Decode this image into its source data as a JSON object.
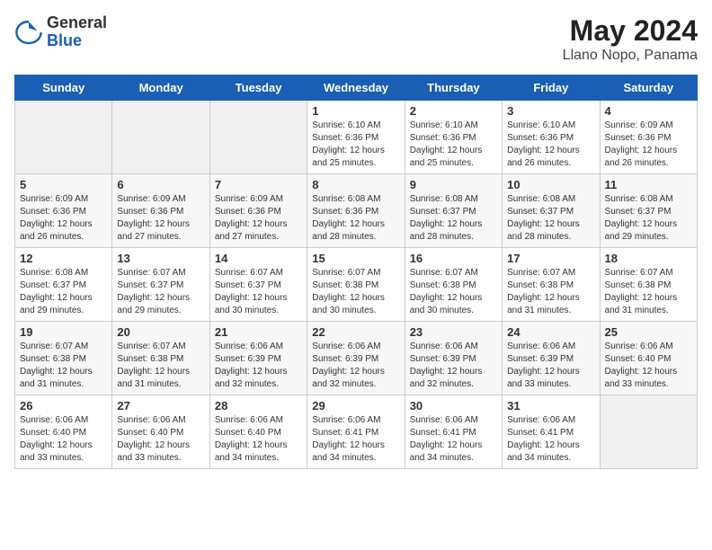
{
  "header": {
    "logo": {
      "general": "General",
      "blue": "Blue"
    },
    "month": "May 2024",
    "location": "Llano Nopo, Panama"
  },
  "weekdays": [
    "Sunday",
    "Monday",
    "Tuesday",
    "Wednesday",
    "Thursday",
    "Friday",
    "Saturday"
  ],
  "weeks": [
    [
      {
        "day": "",
        "info": ""
      },
      {
        "day": "",
        "info": ""
      },
      {
        "day": "",
        "info": ""
      },
      {
        "day": "1",
        "info": "Sunrise: 6:10 AM\nSunset: 6:36 PM\nDaylight: 12 hours\nand 25 minutes."
      },
      {
        "day": "2",
        "info": "Sunrise: 6:10 AM\nSunset: 6:36 PM\nDaylight: 12 hours\nand 25 minutes."
      },
      {
        "day": "3",
        "info": "Sunrise: 6:10 AM\nSunset: 6:36 PM\nDaylight: 12 hours\nand 26 minutes."
      },
      {
        "day": "4",
        "info": "Sunrise: 6:09 AM\nSunset: 6:36 PM\nDaylight: 12 hours\nand 26 minutes."
      }
    ],
    [
      {
        "day": "5",
        "info": "Sunrise: 6:09 AM\nSunset: 6:36 PM\nDaylight: 12 hours\nand 26 minutes."
      },
      {
        "day": "6",
        "info": "Sunrise: 6:09 AM\nSunset: 6:36 PM\nDaylight: 12 hours\nand 27 minutes."
      },
      {
        "day": "7",
        "info": "Sunrise: 6:09 AM\nSunset: 6:36 PM\nDaylight: 12 hours\nand 27 minutes."
      },
      {
        "day": "8",
        "info": "Sunrise: 6:08 AM\nSunset: 6:36 PM\nDaylight: 12 hours\nand 28 minutes."
      },
      {
        "day": "9",
        "info": "Sunrise: 6:08 AM\nSunset: 6:37 PM\nDaylight: 12 hours\nand 28 minutes."
      },
      {
        "day": "10",
        "info": "Sunrise: 6:08 AM\nSunset: 6:37 PM\nDaylight: 12 hours\nand 28 minutes."
      },
      {
        "day": "11",
        "info": "Sunrise: 6:08 AM\nSunset: 6:37 PM\nDaylight: 12 hours\nand 29 minutes."
      }
    ],
    [
      {
        "day": "12",
        "info": "Sunrise: 6:08 AM\nSunset: 6:37 PM\nDaylight: 12 hours\nand 29 minutes."
      },
      {
        "day": "13",
        "info": "Sunrise: 6:07 AM\nSunset: 6:37 PM\nDaylight: 12 hours\nand 29 minutes."
      },
      {
        "day": "14",
        "info": "Sunrise: 6:07 AM\nSunset: 6:37 PM\nDaylight: 12 hours\nand 30 minutes."
      },
      {
        "day": "15",
        "info": "Sunrise: 6:07 AM\nSunset: 6:38 PM\nDaylight: 12 hours\nand 30 minutes."
      },
      {
        "day": "16",
        "info": "Sunrise: 6:07 AM\nSunset: 6:38 PM\nDaylight: 12 hours\nand 30 minutes."
      },
      {
        "day": "17",
        "info": "Sunrise: 6:07 AM\nSunset: 6:38 PM\nDaylight: 12 hours\nand 31 minutes."
      },
      {
        "day": "18",
        "info": "Sunrise: 6:07 AM\nSunset: 6:38 PM\nDaylight: 12 hours\nand 31 minutes."
      }
    ],
    [
      {
        "day": "19",
        "info": "Sunrise: 6:07 AM\nSunset: 6:38 PM\nDaylight: 12 hours\nand 31 minutes."
      },
      {
        "day": "20",
        "info": "Sunrise: 6:07 AM\nSunset: 6:38 PM\nDaylight: 12 hours\nand 31 minutes."
      },
      {
        "day": "21",
        "info": "Sunrise: 6:06 AM\nSunset: 6:39 PM\nDaylight: 12 hours\nand 32 minutes."
      },
      {
        "day": "22",
        "info": "Sunrise: 6:06 AM\nSunset: 6:39 PM\nDaylight: 12 hours\nand 32 minutes."
      },
      {
        "day": "23",
        "info": "Sunrise: 6:06 AM\nSunset: 6:39 PM\nDaylight: 12 hours\nand 32 minutes."
      },
      {
        "day": "24",
        "info": "Sunrise: 6:06 AM\nSunset: 6:39 PM\nDaylight: 12 hours\nand 33 minutes."
      },
      {
        "day": "25",
        "info": "Sunrise: 6:06 AM\nSunset: 6:40 PM\nDaylight: 12 hours\nand 33 minutes."
      }
    ],
    [
      {
        "day": "26",
        "info": "Sunrise: 6:06 AM\nSunset: 6:40 PM\nDaylight: 12 hours\nand 33 minutes."
      },
      {
        "day": "27",
        "info": "Sunrise: 6:06 AM\nSunset: 6:40 PM\nDaylight: 12 hours\nand 33 minutes."
      },
      {
        "day": "28",
        "info": "Sunrise: 6:06 AM\nSunset: 6:40 PM\nDaylight: 12 hours\nand 34 minutes."
      },
      {
        "day": "29",
        "info": "Sunrise: 6:06 AM\nSunset: 6:41 PM\nDaylight: 12 hours\nand 34 minutes."
      },
      {
        "day": "30",
        "info": "Sunrise: 6:06 AM\nSunset: 6:41 PM\nDaylight: 12 hours\nand 34 minutes."
      },
      {
        "day": "31",
        "info": "Sunrise: 6:06 AM\nSunset: 6:41 PM\nDaylight: 12 hours\nand 34 minutes."
      },
      {
        "day": "",
        "info": ""
      }
    ]
  ]
}
